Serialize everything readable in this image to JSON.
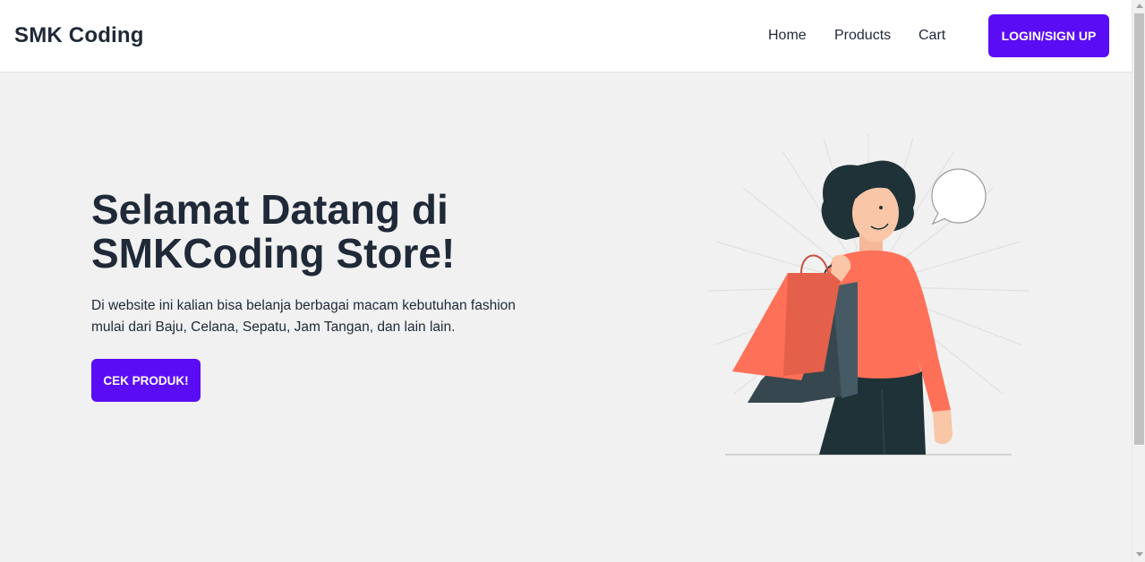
{
  "navbar": {
    "brand": "SMK Coding",
    "links": [
      "Home",
      "Products",
      "Cart"
    ],
    "login_label": "LOGIN/SIGN UP"
  },
  "hero": {
    "title_line1": "Selamat Datang di",
    "title_line2": "SMKCoding Store!",
    "description_line1": "Di website ini kalian bisa belanja berbagai macam kebutuhan fashion",
    "description_line2": "mulai dari Baju, Celana, Sepatu, Jam Tangan, dan lain lain.",
    "cta_label": "CEK PRODUK!",
    "illustration": "woman-with-shopping-bags-illustration"
  },
  "colors": {
    "accent": "#5a0df5",
    "text": "#1f2937",
    "background": "#f1f1f1",
    "shirt": "#fe7158",
    "bag_dark": "#37474f"
  }
}
